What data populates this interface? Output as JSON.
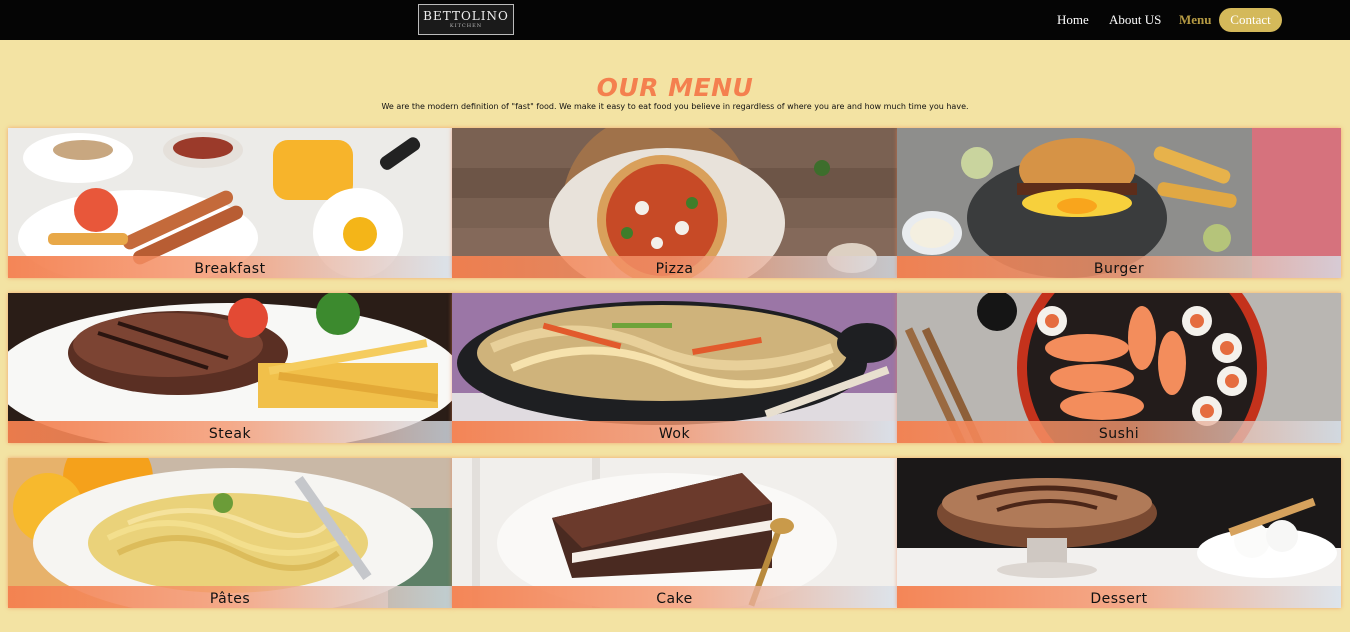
{
  "brand": {
    "name": "BETTOLINO",
    "sub": "KITCHEN"
  },
  "nav": {
    "home": "Home",
    "about": "About US",
    "menu": "Menu",
    "contact": "Contact"
  },
  "page": {
    "title": "OUR MENU",
    "subtitle": "We are the modern definition of \"fast\" food. We make it easy to eat food you believe in regardless of where you are and how much time you have."
  },
  "colors": {
    "accent": "#f4804f",
    "nav_active": "#b59a43",
    "contact_bg": "#d4b95a",
    "page_bg": "#f3e3a3"
  },
  "menu_items": [
    {
      "label": "Breakfast",
      "icon": "breakfast-photo"
    },
    {
      "label": "Pizza",
      "icon": "pizza-photo"
    },
    {
      "label": "Burger",
      "icon": "burger-photo"
    },
    {
      "label": "Steak",
      "icon": "steak-photo"
    },
    {
      "label": "Wok",
      "icon": "wok-photo"
    },
    {
      "label": "Sushi",
      "icon": "sushi-photo"
    },
    {
      "label": "Pâtes",
      "icon": "pasta-photo"
    },
    {
      "label": "Cake",
      "icon": "cake-photo"
    },
    {
      "label": "Dessert",
      "icon": "dessert-photo"
    }
  ]
}
